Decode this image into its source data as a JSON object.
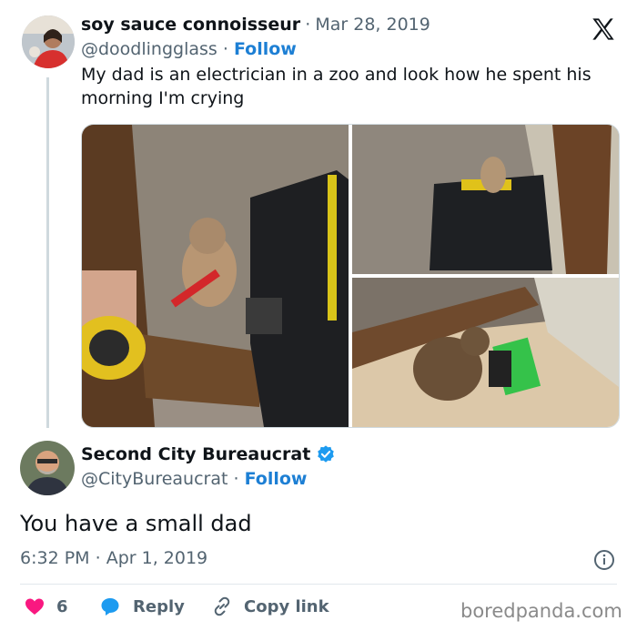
{
  "original_tweet": {
    "display_name": "soy sauce connoisseur",
    "separator": "·",
    "date": "Mar 28, 2019",
    "handle": "@doodlingglass",
    "follow_label": "Follow",
    "text_line1": "My dad is an electrician in a zoo and look how he spent his",
    "text_line2": "morning I'm crying",
    "platform_icon": "x-logo-icon",
    "avatar_icon": "user-avatar"
  },
  "reply_tweet": {
    "display_name": "Second City Bureaucrat",
    "verified_icon": "verified-badge-icon",
    "handle": "@CityBureaucrat",
    "follow_label": "Follow",
    "text": "You have a small dad",
    "time": "6:32 PM",
    "date": "Apr 1, 2019",
    "info_icon": "info-icon"
  },
  "actions": {
    "likes_count": "6",
    "reply_label": "Reply",
    "copy_link_label": "Copy link"
  },
  "watermark": "boredpanda.com",
  "colors": {
    "follow_blue": "#1d7fd4",
    "like_pink": "#f91880",
    "reply_blue": "#1d9bf0",
    "verified_blue": "#1d9bf0",
    "muted": "#536471"
  }
}
